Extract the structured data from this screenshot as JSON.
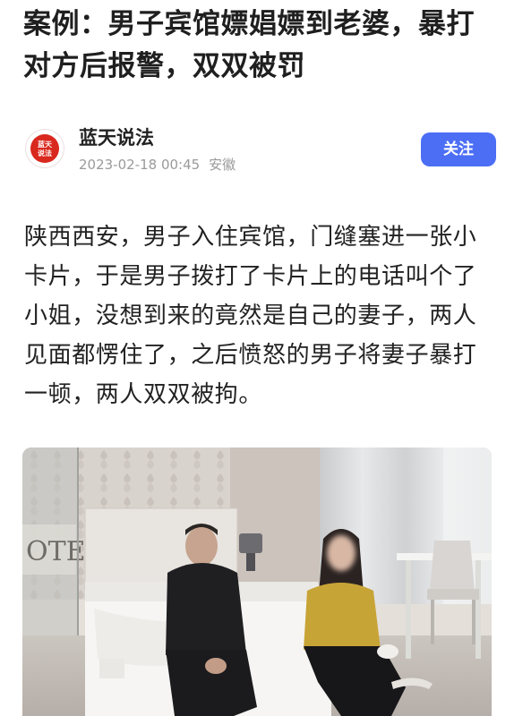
{
  "article": {
    "title": "案例：男子宾馆嫖娼嫖到老婆，暴打对方后报警，双双被罚",
    "author": {
      "name": "蓝天说法",
      "avatar_text": "蓝天说法",
      "date": "2023-02-18 00:45",
      "location": "安徽"
    },
    "follow_label": "关注",
    "body": "陕西西安，男子入住宾馆，门缝塞进一张小卡片，于是男子拨打了卡片上的电话叫个了小姐，没想到来的竟然是自己的妻子，两人见面都愣住了，之后愤怒的男子将妻子暴打一顿，两人双双被拘。",
    "photo": {
      "sign_text": "OTE"
    }
  },
  "colors": {
    "accent": "#4b6ef5",
    "avatar_red": "#d9281e",
    "meta_gray": "#9a9a9a"
  }
}
